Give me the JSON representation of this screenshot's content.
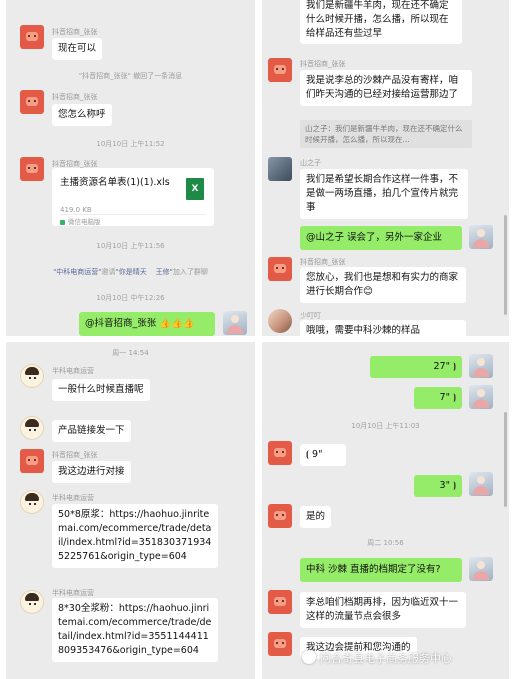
{
  "panels": {
    "top_left": {
      "sender_1": "抖音招商_张张",
      "msg_1": "现在可以",
      "recall": "\"抖音招商_张张\" 撤回了一条消息",
      "sender_2": "抖音招商_张张",
      "msg_2": "您怎么称呼",
      "time_1": "10月10日 上午11:52",
      "sender_3": "抖音招商_张张",
      "file_name": "主播资源名单表(1)(1).xls",
      "file_size": "419.0 KB",
      "file_source": "微信电脑版",
      "time_2": "10月10日 上午11:56",
      "join_a": "\"中科电商运营\"",
      "join_b": "邀请",
      "join_c": "\"你是晴天",
      "join_d": "王修\"",
      "join_e": "加入了群聊",
      "time_3": "10月10日 中午12:26",
      "my_msg": "@抖音招商_张张 👍👍👍"
    },
    "top_right": {
      "top_msg": "我们是新疆牛羊肉，现在还不确定什么时候开播，怎么播，所以现在给样品还有些过早",
      "sender_1": "抖音招商_张张",
      "msg_1": "我是说李总的沙棘产品没有寄样，咱们昨天沟通的已经对接给运营那边了",
      "quote": "山之子：我们是新疆牛羊肉，现在还不确定什么时候开播，怎么播，所以现在...",
      "sender_2": "山之子",
      "msg_2": "我们是希望长期合作这样一件事，不是做一两场直播，拍几个宣传片就完事",
      "my_msg": "@山之子 误会了，另外一家企业",
      "sender_3": "抖音招商_张张",
      "msg_3": "您放心，我们也是想和有实力的商家进行长期合作😊",
      "sender_4": "少叮叮",
      "msg_4": "哦哦，需要中科沙棘的样品"
    },
    "bottom_left": {
      "time_1": "周一 14:54",
      "sender_1": "半科电商运营",
      "msg_1": "一般什么时候直播呢",
      "msg_2": "产品链接发一下",
      "sender_2": "抖音招商_张张",
      "msg_3": "我这边进行对接",
      "sender_3": "半科电商运营",
      "msg_4": "50*8原浆：https://haohuo.jinritemai.com/ecommerce/trade/detail/index.html?id=3518303719345225761&origin_type=604",
      "sender_4": "半科电商运营",
      "msg_5": "8*30全浆粉：https://haohuo.jinritemai.com/ecommerce/trade/detail/index.html?id=3551144411809353476&origin_type=604"
    },
    "bottom_right": {
      "voice_1": "27\"",
      "voice_2": "7\"",
      "time_1": "10月10日 上午11:03",
      "voice_3": "9\"",
      "voice_4": "3\"",
      "msg_1": "是的",
      "time_2": "周二 10:56",
      "my_msg": "中科 沙棘 直播的档期定了没有?",
      "msg_2": "李总咱们档期再排，因为临近双十一这样的流量节点会很多",
      "msg_3": "我这边会提前和您沟通的"
    }
  },
  "watermark": "阿合奇县电子商务服务中心",
  "icons": {
    "voice": "voice-wave-icon",
    "excel": "excel-file-icon"
  },
  "colors": {
    "chat_bg": "#ebebeb",
    "bubble_other": "#ffffff",
    "bubble_self": "#95ec69",
    "link_blue": "#576b95",
    "excel_green": "#1d8b45"
  }
}
